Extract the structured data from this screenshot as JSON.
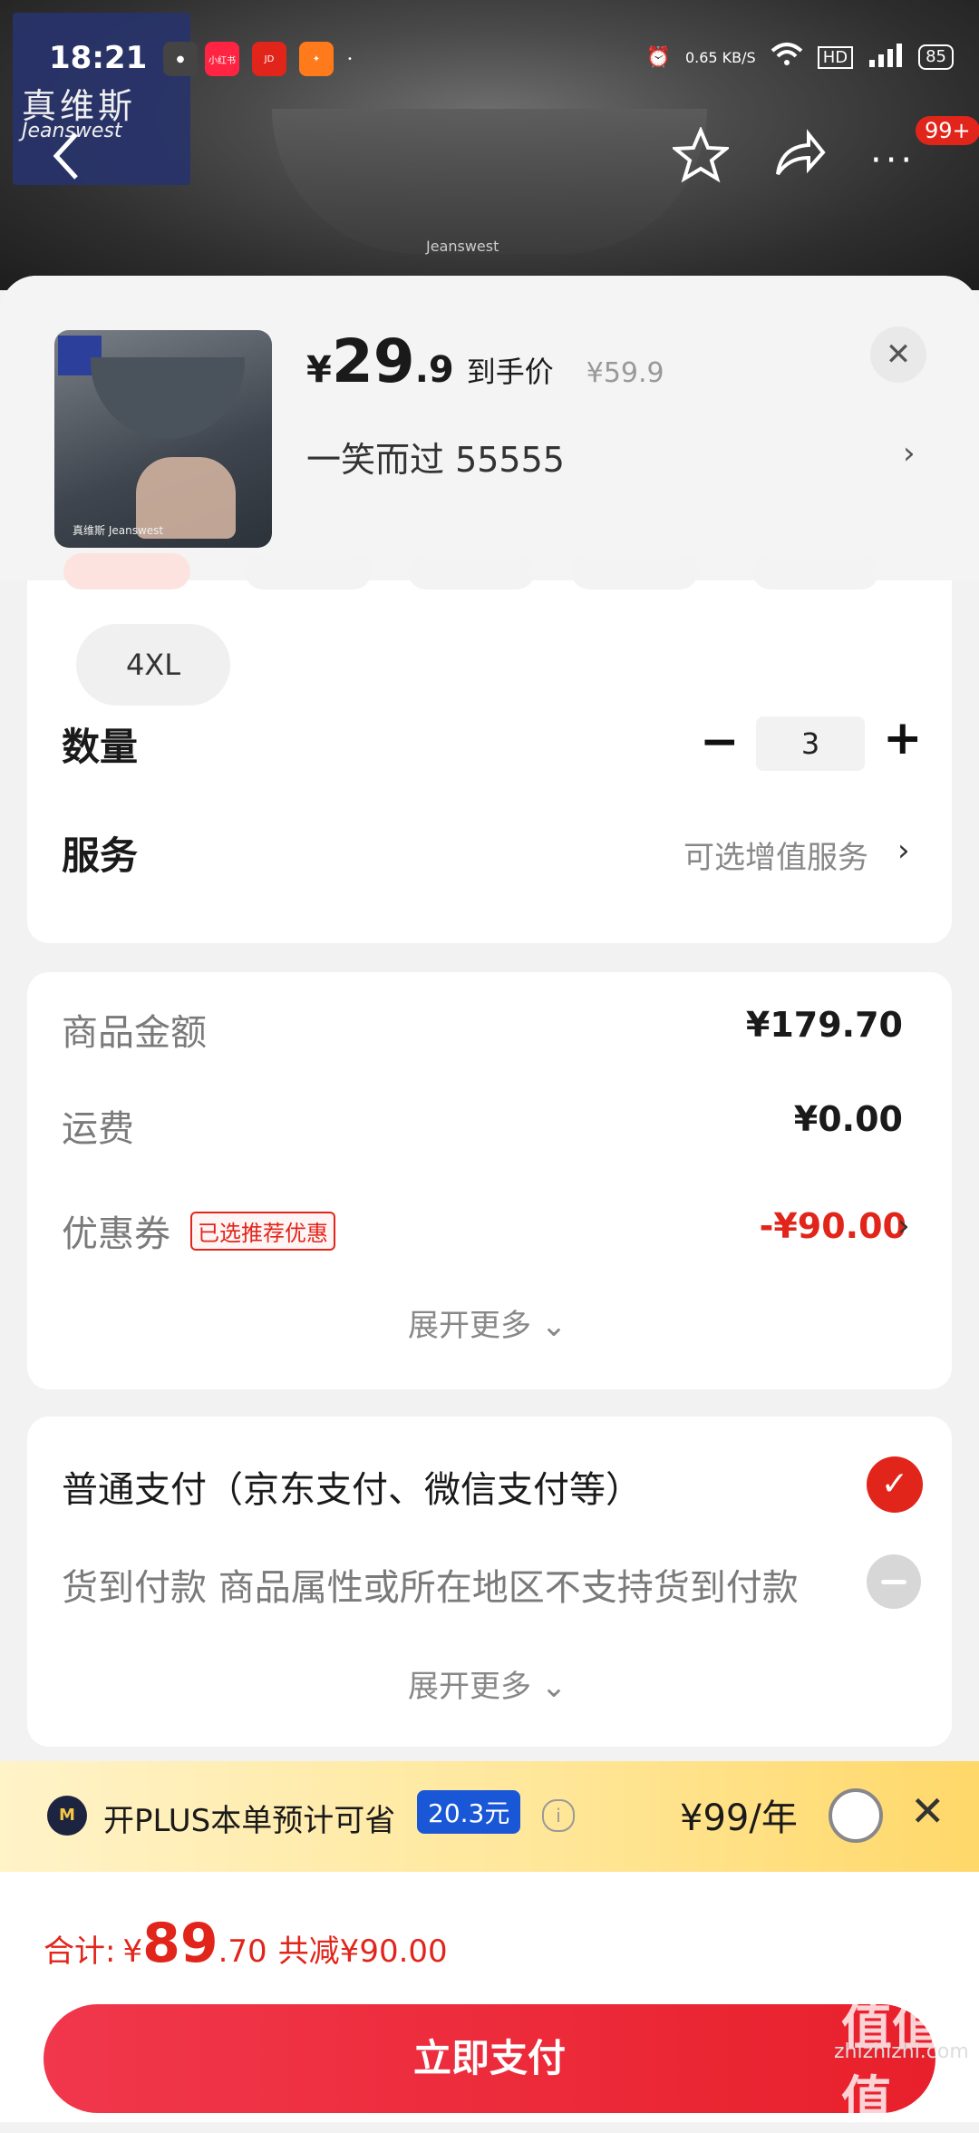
{
  "status_bar": {
    "time": "18:21",
    "network_speed": "0.65 KB/S",
    "battery": "85",
    "apps": [
      "小红书"
    ]
  },
  "hero": {
    "brand_logo_cn": "真维斯",
    "brand_logo_en": "Jeanswest",
    "product_tag": "Jeanswest",
    "badge": "99+"
  },
  "product": {
    "thumb_brand": "真维斯 Jeanswest",
    "price_yen": "¥",
    "price_int": "29",
    "price_dec": ".9",
    "price_label": "到手价",
    "original_price": "¥59.9",
    "variant": "一笑而过  55555",
    "variant_arrow": "›"
  },
  "spec": {
    "size": "4XL",
    "qty_label": "数量",
    "qty_minus": "−",
    "qty_value": "3",
    "qty_plus": "+",
    "service_label": "服务",
    "service_hint": "可选增值服务",
    "service_arrow": "›"
  },
  "summary": {
    "goods_label": "商品金额",
    "goods_value": "¥179.70",
    "shipping_label": "运费",
    "shipping_value": "¥0.00",
    "coupon_label": "优惠券",
    "coupon_tag": "已选推荐优惠",
    "coupon_value": "-¥90.00",
    "coupon_arrow": "›",
    "expand": "展开更多 ⌄"
  },
  "payment": {
    "normal_label": "普通支付（京东支付、微信支付等）",
    "normal_check": "✓",
    "cod_label": "货到付款   商品属性或所在地区不支持货到付款",
    "expand": "展开更多 ⌄"
  },
  "plus": {
    "icon": "M",
    "text": "开PLUS本单预计可省",
    "saving": "20.3元",
    "info": "i",
    "price": "¥99/年",
    "close": "✕"
  },
  "footer": {
    "total_label": "合计:",
    "total_yen": "¥",
    "total_int": "89",
    "total_dec": ".70",
    "total_saved": "共减¥90.00",
    "pay_button": "立即支付"
  },
  "watermark": {
    "main": "值值值",
    "site": "zhizhizhi.com"
  },
  "colors": {
    "accent": "#e1251b",
    "plus_blue": "#1a57d6"
  }
}
